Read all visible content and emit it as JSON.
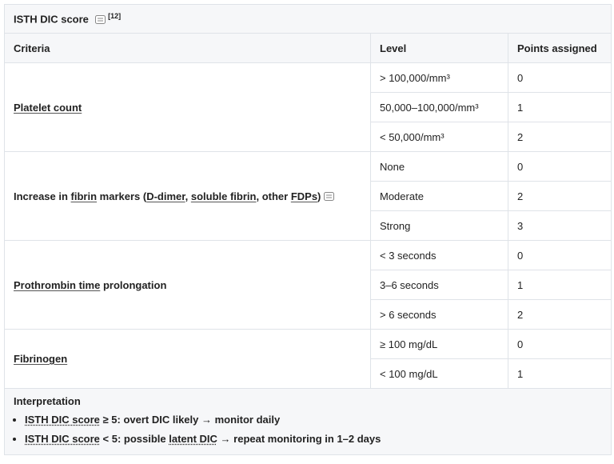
{
  "caption": {
    "title": "ISTH DIC score",
    "ref": "[12]"
  },
  "columns": {
    "criteria": "Criteria",
    "level": "Level",
    "points": "Points assigned"
  },
  "groups": [
    {
      "criteria": "Platelet count",
      "rows": [
        {
          "level": "> 100,000/mm³",
          "points": "0"
        },
        {
          "level": "50,000–100,000/mm³",
          "points": "1"
        },
        {
          "level": "< 50,000/mm³",
          "points": "2"
        }
      ]
    },
    {
      "criteria_parts": {
        "a": "Increase in ",
        "b": "fibrin",
        "c": " markers (",
        "d": "D-dimer",
        "e": ", ",
        "f": "soluble fibrin",
        "g": ", other ",
        "h": "FDPs",
        "i": ")"
      },
      "rows": [
        {
          "level": "None",
          "points": "0"
        },
        {
          "level": "Moderate",
          "points": "2"
        },
        {
          "level": "Strong",
          "points": "3"
        }
      ]
    },
    {
      "criteria_parts": {
        "a": "Prothrombin time",
        "b": " prolongation"
      },
      "rows": [
        {
          "level": "< 3 seconds",
          "points": "0"
        },
        {
          "level": "3–6 seconds",
          "points": "1"
        },
        {
          "level": "> 6 seconds",
          "points": "2"
        }
      ]
    },
    {
      "criteria": "Fibrinogen",
      "rows": [
        {
          "level": "≥ 100 mg/dL",
          "points": "0"
        },
        {
          "level": "< 100 mg/dL",
          "points": "1"
        }
      ]
    }
  ],
  "interpretation": {
    "heading": "Interpretation",
    "items": [
      {
        "a": "ISTH DIC score",
        "b": " ≥ 5: overt DIC likely → monitor daily"
      },
      {
        "a": "ISTH DIC score",
        "b": " < 5: possible ",
        "c": "latent DIC",
        "d": " → repeat monitoring in 1–2 days"
      }
    ]
  }
}
